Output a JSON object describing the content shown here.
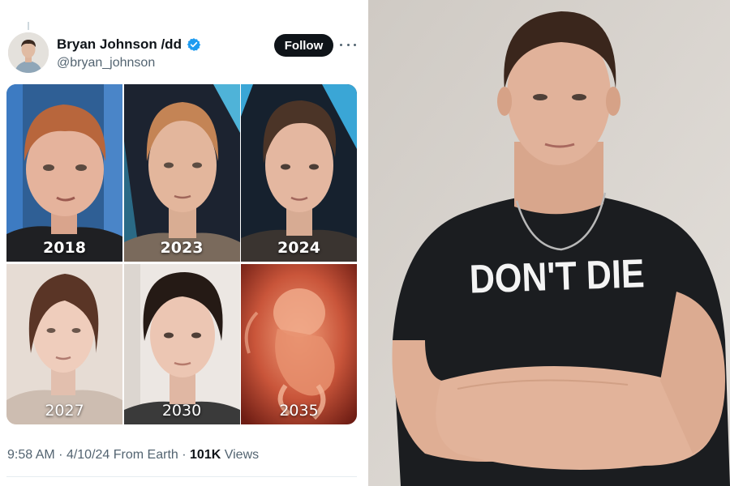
{
  "tweet": {
    "author": {
      "display_name": "Bryan Johnson /dd",
      "handle": "@bryan_johnson",
      "verified": true,
      "avatar_icon": "profile-photo"
    },
    "follow_label": "Follow",
    "more_icon": "ellipsis-icon",
    "media": [
      {
        "year": "2018"
      },
      {
        "year": "2023"
      },
      {
        "year": "2024"
      },
      {
        "year": "2027"
      },
      {
        "year": "2030"
      },
      {
        "year": "2035"
      }
    ],
    "meta": {
      "time": "9:58 AM",
      "separator": "·",
      "date": "4/10/24",
      "source": "From Earth",
      "views_count": "101K",
      "views_label": "Views"
    }
  },
  "photo": {
    "shirt_text": "DON'T DIE"
  },
  "colors": {
    "text_primary": "#0f1419",
    "text_secondary": "#536471",
    "verified_blue": "#1d9bf0",
    "follow_bg": "#0f1419"
  }
}
